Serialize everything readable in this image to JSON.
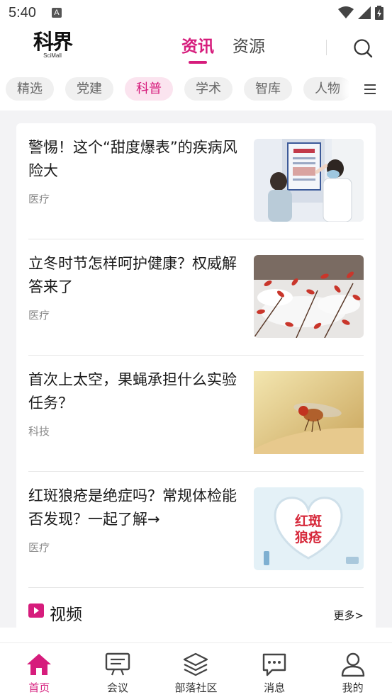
{
  "status_bar": {
    "time": "5:40",
    "notification_icon": "A"
  },
  "header": {
    "logo_text": "科界",
    "logo_subtext": "SciMall",
    "tabs": [
      {
        "label": "资讯",
        "active": true
      },
      {
        "label": "资源",
        "active": false
      }
    ],
    "search_icon": "search-icon"
  },
  "categories": {
    "items": [
      {
        "label": "精选",
        "active": false
      },
      {
        "label": "党建",
        "active": false
      },
      {
        "label": "科普",
        "active": true
      },
      {
        "label": "学术",
        "active": false
      },
      {
        "label": "智库",
        "active": false
      },
      {
        "label": "人物",
        "active": false
      }
    ],
    "menu_icon": "menu-icon"
  },
  "articles": [
    {
      "title": "警惕！这个“甜度爆表”的疾病风险大",
      "tag": "医疗"
    },
    {
      "title": "立冬时节怎样呵护健康？权威解答来了",
      "tag": "医疗"
    },
    {
      "title": "首次上太空，果蝇承担什么实验任务？",
      "tag": "科技"
    },
    {
      "title": "红斑狼疮是绝症吗？常规体检能否发现？一起了解→",
      "tag": "医疗",
      "thumb_text_1": "红斑",
      "thumb_text_2": "狼疮"
    }
  ],
  "video_section": {
    "title": "视频",
    "more": "更多>"
  },
  "bottom_nav": [
    {
      "label": "首页",
      "icon": "home-icon",
      "active": true
    },
    {
      "label": "会议",
      "icon": "meeting-icon",
      "active": false
    },
    {
      "label": "部落社区",
      "icon": "layers-icon",
      "active": false
    },
    {
      "label": "消息",
      "icon": "message-icon",
      "active": false
    },
    {
      "label": "我的",
      "icon": "user-icon",
      "active": false
    }
  ],
  "colors": {
    "accent": "#d61c7c",
    "accent_light": "#fbe4ef",
    "background": "#f3f3f5"
  }
}
